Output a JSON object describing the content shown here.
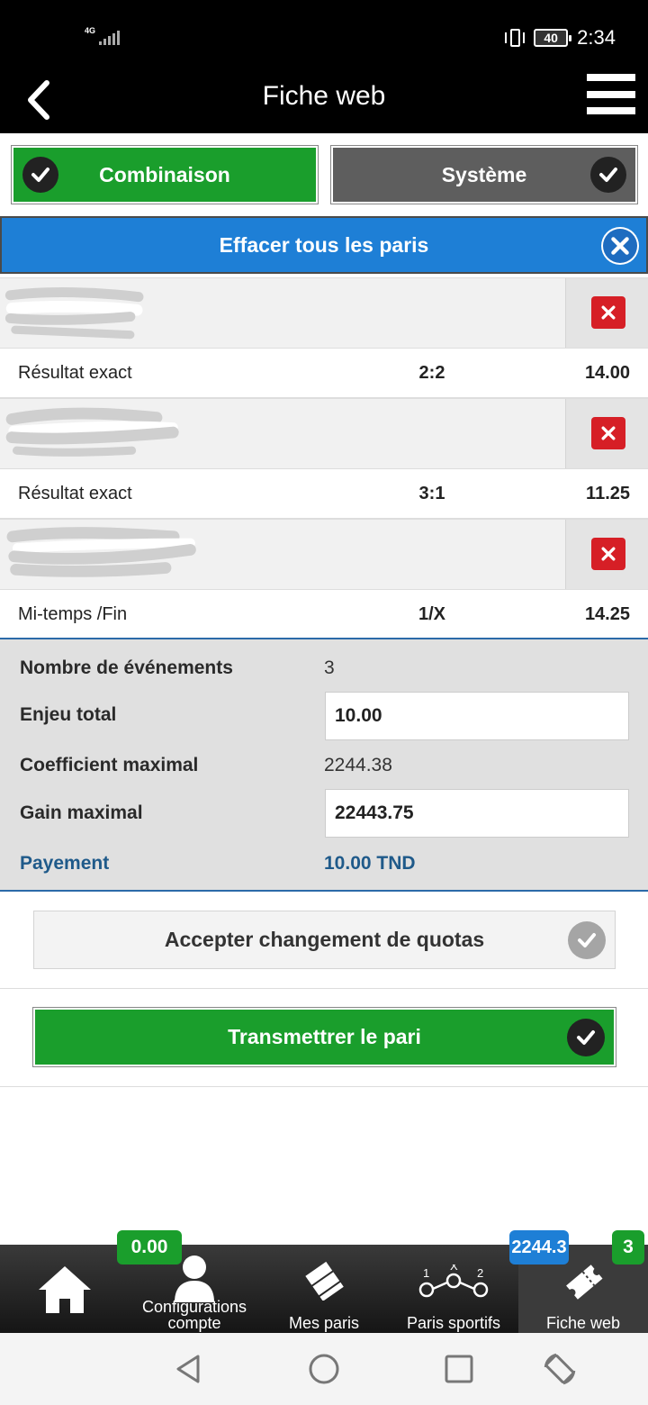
{
  "status_bar": {
    "network": "4G",
    "battery": "40",
    "time": "2:34"
  },
  "header": {
    "title": "Fiche web"
  },
  "modes": {
    "combination": "Combinaison",
    "system": "Système"
  },
  "clear_all": "Effacer tous les paris",
  "bets": [
    {
      "market": "Résultat exact",
      "pick": "2:2",
      "odd": "14.00"
    },
    {
      "market": "Résultat exact",
      "pick": "3:1",
      "odd": "11.25"
    },
    {
      "market": "Mi-temps /Fin",
      "pick": "1/X",
      "odd": "14.25"
    }
  ],
  "summary": {
    "events_label": "Nombre de événements",
    "events_value": "3",
    "stake_label": "Enjeu total",
    "stake_value": "10.00",
    "coef_label": "Coefficient maximal",
    "coef_value": "2244.38",
    "gain_label": "Gain maximal",
    "gain_value": "22443.75",
    "payment_label": "Payement",
    "payment_value": "10.00 TND"
  },
  "accept_label": "Accepter changement de quotas",
  "submit_label": "Transmettrer le pari",
  "bottom_nav": {
    "home": "",
    "account": "Configurations compte",
    "account_badge": "0.00",
    "my_bets": "Mes paris",
    "sports": "Paris sportifs",
    "sports_badge": "2244.3",
    "betslip": "Fiche web",
    "betslip_badge": "3",
    "sports_icon": {
      "left": "1",
      "middle": "X",
      "right": "2"
    }
  },
  "colors": {
    "green": "#1a9e2c",
    "blue": "#1e7fd6",
    "red": "#d61f26",
    "grey": "#5e5e5e"
  }
}
